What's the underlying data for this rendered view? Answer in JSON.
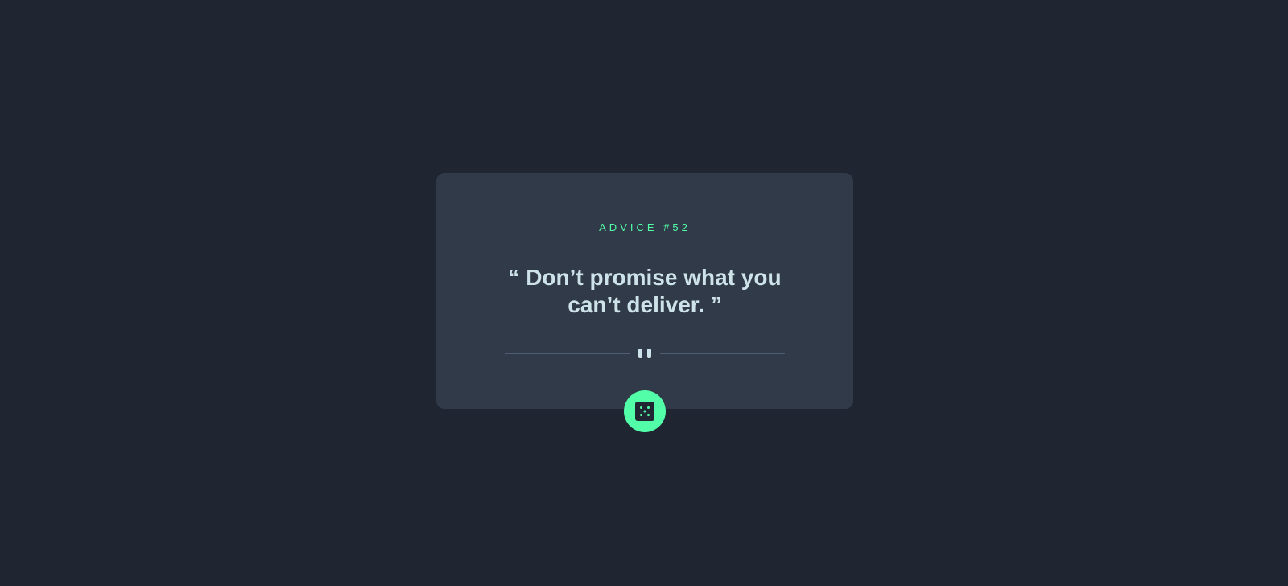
{
  "card": {
    "advice_label": "ADVICE #52",
    "quote": "“ Don’t promise what you can’t deliver. ”"
  },
  "divider": {
    "icon": "pause-icon"
  },
  "dice_button": {
    "icon": "dice-icon"
  },
  "colors": {
    "background": "#1f2632",
    "card": "#313a48",
    "accent": "#52ffa8",
    "text": "#cee3e9",
    "divider": "#4f5d74"
  }
}
